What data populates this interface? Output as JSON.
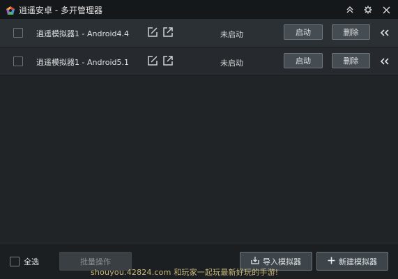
{
  "window": {
    "title": "逍遥安卓 - 多开管理器"
  },
  "emulators": [
    {
      "name": "逍遥模拟器1 - Android4.4",
      "status": "未启动",
      "start_label": "启动",
      "delete_label": "删除"
    },
    {
      "name": "逍遥模拟器1 - Android5.1",
      "status": "未启动",
      "start_label": "启动",
      "delete_label": "删除"
    }
  ],
  "footer": {
    "select_all_label": "全选",
    "batch_label": "批量操作",
    "import_label": "导入模拟器",
    "new_label": "新建模拟器"
  },
  "watermark": "shouyou.42824.com 和玩家一起玩最新好玩的手游!",
  "colors": {
    "titlebar": "#15181a",
    "row_highlight": "#2b3034",
    "button_bg": "#454c52",
    "watermark": "#e8d48a"
  },
  "icons": {
    "app": "xiaoyao-logo-icon",
    "collapse": "double-chevron-up-icon",
    "settings": "gear-icon",
    "close": "close-icon",
    "edit": "edit-icon",
    "open": "external-link-icon",
    "row_more": "double-chevron-left-icon",
    "import": "import-icon",
    "new": "plus-icon"
  }
}
